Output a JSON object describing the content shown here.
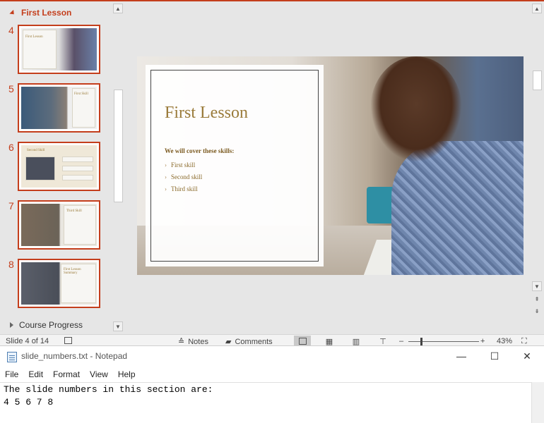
{
  "powerpoint": {
    "section_name": "First Lesson",
    "next_section_name": "Course Progress",
    "thumbnails": [
      {
        "number": "4",
        "title": "First Lesson"
      },
      {
        "number": "5",
        "title": "First Skill"
      },
      {
        "number": "6",
        "title": "Second Skill"
      },
      {
        "number": "7",
        "title": "Third Skill"
      },
      {
        "number": "8",
        "title": "First Lesson Summary"
      }
    ],
    "slide": {
      "title": "First Lesson",
      "subtitle": "We will cover these skills:",
      "bullets": [
        "First skill",
        "Second skill",
        "Third skill"
      ]
    },
    "status": {
      "slide_indicator": "Slide 4 of 14",
      "notes_label": "Notes",
      "comments_label": "Comments",
      "zoom_minus": "–",
      "zoom_plus": "+",
      "zoom_level": "43%"
    },
    "colors": {
      "accent": "#c43e1c",
      "slide_title": "#9a7b3a"
    }
  },
  "notepad": {
    "title": "slide_numbers.txt - Notepad",
    "menu": [
      "File",
      "Edit",
      "Format",
      "View",
      "Help"
    ],
    "lines": [
      "The slide numbers in this section are:",
      "4 5 6 7 8"
    ]
  }
}
